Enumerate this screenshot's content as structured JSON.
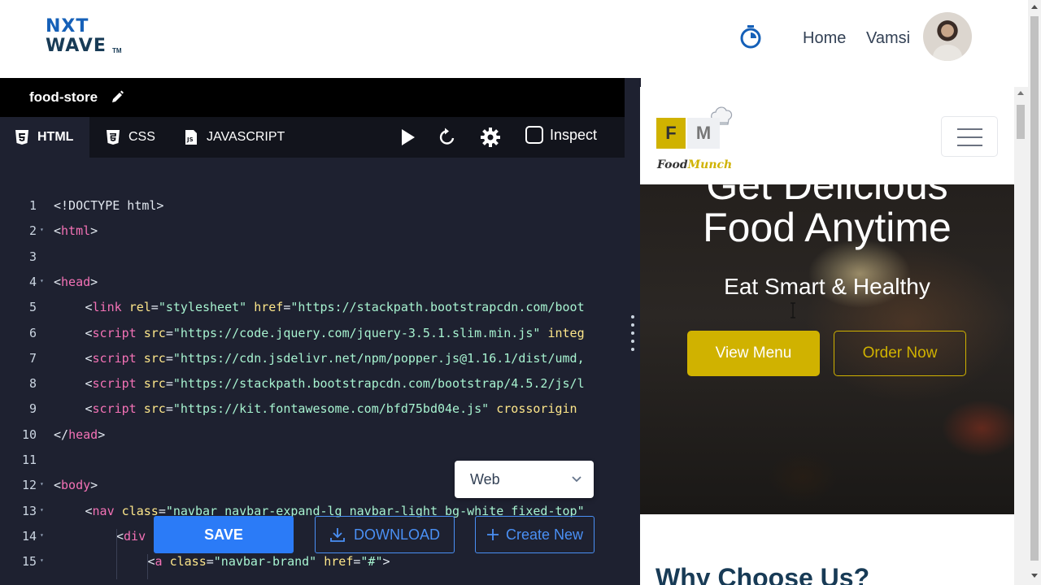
{
  "header": {
    "logo_line1": "NXT",
    "logo_line2": "WAVE",
    "logo_tm": "TM",
    "nav_home": "Home",
    "user_name": "Vamsi"
  },
  "editor": {
    "project_name": "food-store",
    "tabs": [
      {
        "label": "HTML",
        "active": true
      },
      {
        "label": "CSS",
        "active": false
      },
      {
        "label": "JAVASCRIPT",
        "active": false
      }
    ],
    "inspect_label": "Inspect",
    "view_mode": "Web",
    "save_label": "SAVE",
    "download_label": "DOWNLOAD",
    "create_new_label": "Create New",
    "lines": [
      {
        "n": "1",
        "fold": "",
        "indent": 0
      },
      {
        "n": "2",
        "fold": "▾",
        "indent": 0
      },
      {
        "n": "3",
        "fold": "",
        "indent": 0
      },
      {
        "n": "4",
        "fold": "▾",
        "indent": 0
      },
      {
        "n": "5",
        "fold": "",
        "indent": 1
      },
      {
        "n": "6",
        "fold": "",
        "indent": 1
      },
      {
        "n": "7",
        "fold": "",
        "indent": 1
      },
      {
        "n": "8",
        "fold": "",
        "indent": 1
      },
      {
        "n": "9",
        "fold": "",
        "indent": 1
      },
      {
        "n": "10",
        "fold": "",
        "indent": 0
      },
      {
        "n": "11",
        "fold": "",
        "indent": 0
      },
      {
        "n": "12",
        "fold": "▾",
        "indent": 0
      },
      {
        "n": "13",
        "fold": "▾",
        "indent": 1
      },
      {
        "n": "14",
        "fold": "▾",
        "indent": 2
      },
      {
        "n": "15",
        "fold": "▾",
        "indent": 3
      }
    ],
    "code": [
      [
        {
          "c": "p",
          "t": "<!DOCTYPE html>"
        }
      ],
      [
        {
          "c": "p",
          "t": "<"
        },
        {
          "c": "t",
          "t": "html"
        },
        {
          "c": "p",
          "t": ">"
        }
      ],
      [],
      [
        {
          "c": "p",
          "t": "<"
        },
        {
          "c": "t",
          "t": "head"
        },
        {
          "c": "p",
          "t": ">"
        }
      ],
      [
        {
          "c": "p",
          "t": "<"
        },
        {
          "c": "t",
          "t": "link"
        },
        {
          "c": "p",
          "t": " "
        },
        {
          "c": "a",
          "t": "rel"
        },
        {
          "c": "p",
          "t": "="
        },
        {
          "c": "v",
          "t": "\"stylesheet\""
        },
        {
          "c": "p",
          "t": " "
        },
        {
          "c": "a",
          "t": "href"
        },
        {
          "c": "p",
          "t": "="
        },
        {
          "c": "v",
          "t": "\"https://stackpath.bootstrapcdn.com/boot"
        }
      ],
      [
        {
          "c": "p",
          "t": "<"
        },
        {
          "c": "t",
          "t": "script"
        },
        {
          "c": "p",
          "t": " "
        },
        {
          "c": "a",
          "t": "src"
        },
        {
          "c": "p",
          "t": "="
        },
        {
          "c": "v",
          "t": "\"https://code.jquery.com/jquery-3.5.1.slim.min.js\""
        },
        {
          "c": "p",
          "t": " "
        },
        {
          "c": "a",
          "t": "integ"
        }
      ],
      [
        {
          "c": "p",
          "t": "<"
        },
        {
          "c": "t",
          "t": "script"
        },
        {
          "c": "p",
          "t": " "
        },
        {
          "c": "a",
          "t": "src"
        },
        {
          "c": "p",
          "t": "="
        },
        {
          "c": "v",
          "t": "\"https://cdn.jsdelivr.net/npm/popper.js@1.16.1/dist/umd,"
        }
      ],
      [
        {
          "c": "p",
          "t": "<"
        },
        {
          "c": "t",
          "t": "script"
        },
        {
          "c": "p",
          "t": " "
        },
        {
          "c": "a",
          "t": "src"
        },
        {
          "c": "p",
          "t": "="
        },
        {
          "c": "v",
          "t": "\"https://stackpath.bootstrapcdn.com/bootstrap/4.5.2/js/l"
        }
      ],
      [
        {
          "c": "p",
          "t": "<"
        },
        {
          "c": "t",
          "t": "script"
        },
        {
          "c": "p",
          "t": " "
        },
        {
          "c": "a",
          "t": "src"
        },
        {
          "c": "p",
          "t": "="
        },
        {
          "c": "v",
          "t": "\"https://kit.fontawesome.com/bfd75bd04e.js\""
        },
        {
          "c": "p",
          "t": " "
        },
        {
          "c": "a",
          "t": "crossorigin"
        }
      ],
      [
        {
          "c": "p",
          "t": "</"
        },
        {
          "c": "t",
          "t": "head"
        },
        {
          "c": "p",
          "t": ">"
        }
      ],
      [],
      [
        {
          "c": "p",
          "t": "<"
        },
        {
          "c": "t",
          "t": "body"
        },
        {
          "c": "p",
          "t": ">"
        }
      ],
      [
        {
          "c": "p",
          "t": "<"
        },
        {
          "c": "t",
          "t": "nav"
        },
        {
          "c": "p",
          "t": " "
        },
        {
          "c": "a",
          "t": "class"
        },
        {
          "c": "p",
          "t": "="
        },
        {
          "c": "v",
          "t": "\"navbar navbar-expand-lg navbar-light bg-white fixed-top\""
        }
      ],
      [
        {
          "c": "p",
          "t": "<"
        },
        {
          "c": "t",
          "t": "div"
        }
      ],
      [
        {
          "c": "p",
          "t": "<"
        },
        {
          "c": "t",
          "t": "a"
        },
        {
          "c": "p",
          "t": " "
        },
        {
          "c": "a",
          "t": "class"
        },
        {
          "c": "p",
          "t": "="
        },
        {
          "c": "v",
          "t": "\"navbar-brand\""
        },
        {
          "c": "p",
          "t": " "
        },
        {
          "c": "a",
          "t": "href"
        },
        {
          "c": "p",
          "t": "="
        },
        {
          "c": "v",
          "t": "\"#\""
        },
        {
          "c": "p",
          "t": ">"
        }
      ]
    ]
  },
  "preview": {
    "logo_f": "F",
    "logo_m": "M",
    "logo_text_a": "Food",
    "logo_text_b": "Munch",
    "hero_line1": "Get Delicious",
    "hero_line2": "Food Anytime",
    "hero_sub": "Eat Smart & Healthy",
    "btn_view_menu": "View Menu",
    "btn_order_now": "Order Now",
    "section_title": "Why Choose Us?"
  },
  "colors": {
    "accent_blue": "#2b7bf7",
    "brand_yellow": "#d0b200",
    "editor_bg": "#1e2130",
    "tag_pink": "#f472b6",
    "attr_yellow": "#fde68a",
    "value_green": "#a7f3d0"
  },
  "icons": {
    "timer": "stopwatch-icon",
    "edit": "pencil-icon",
    "html": "html5-icon",
    "css": "css3-icon",
    "js": "js-file-icon",
    "run": "play-icon",
    "reset": "refresh-icon",
    "settings": "gear-icon",
    "download": "download-icon",
    "create": "plus-icon",
    "menu": "hamburger-icon"
  }
}
